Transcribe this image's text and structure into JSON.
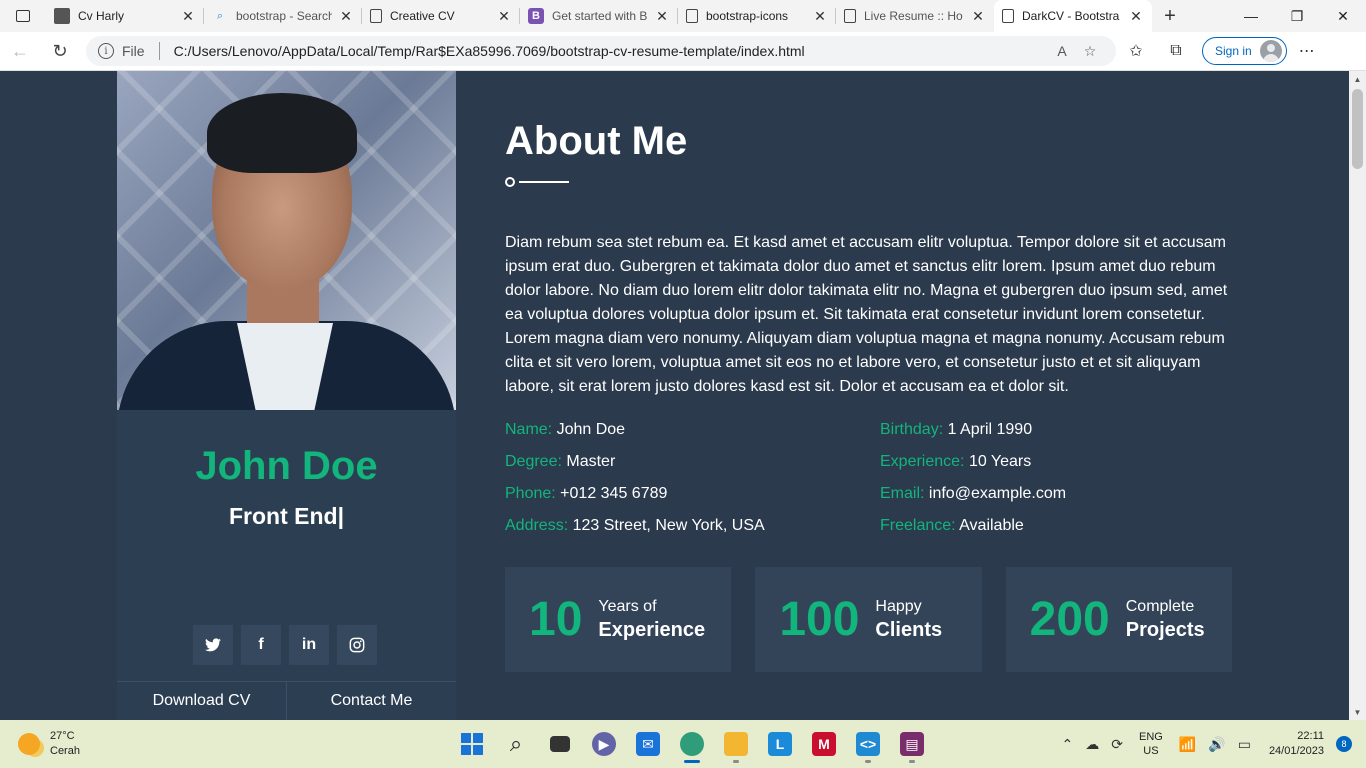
{
  "browser": {
    "tabs": [
      {
        "title": "Cv Harly",
        "icon": "user-photo-icon"
      },
      {
        "title": "bootstrap - Search",
        "icon": "search-icon"
      },
      {
        "title": "Creative CV",
        "icon": "page-icon"
      },
      {
        "title": "Get started with B",
        "icon": "bootstrap-icon"
      },
      {
        "title": "bootstrap-icons",
        "icon": "page-icon"
      },
      {
        "title": "Live Resume :: Ho",
        "icon": "page-icon"
      },
      {
        "title": "DarkCV - Bootstra",
        "icon": "page-icon",
        "active": true
      }
    ],
    "address": {
      "file_label": "File",
      "url": "C:/Users/Lenovo/AppData/Local/Temp/Rar$EXa85996.7069/bootstrap-cv-resume-template/index.html"
    },
    "sign_in_label": "Sign in"
  },
  "sidebar": {
    "name": "John Doe",
    "role": "Front End|",
    "socials": [
      {
        "name": "twitter-icon",
        "glyph": "🐦"
      },
      {
        "name": "facebook-icon",
        "glyph": "f"
      },
      {
        "name": "linkedin-icon",
        "glyph": "in"
      },
      {
        "name": "instagram-icon",
        "glyph": "◎"
      }
    ],
    "buttons": {
      "download": "Download CV",
      "contact": "Contact Me"
    }
  },
  "about": {
    "title": "About Me",
    "text": "Diam rebum sea stet rebum ea. Et kasd amet et accusam elitr voluptua. Tempor dolore sit et accusam ipsum erat duo. Gubergren et takimata dolor duo amet et sanctus elitr lorem. Ipsum amet duo rebum dolor labore. No diam duo lorem elitr dolor takimata elitr no. Magna et gubergren duo ipsum sed, amet ea voluptua dolores voluptua dolor ipsum et. Sit takimata erat consetetur invidunt lorem consetetur. Lorem magna diam vero nonumy. Aliquyam diam voluptua magna et magna nonumy. Accusam rebum clita et sit vero lorem, voluptua amet sit eos no et labore vero, et consetetur justo et et sit aliquyam labore, sit erat lorem justo dolores kasd est sit. Dolor et accusam ea et dolor sit.",
    "info": [
      {
        "key": "Name:",
        "value": "John Doe"
      },
      {
        "key": "Birthday:",
        "value": "1 April 1990"
      },
      {
        "key": "Degree:",
        "value": "Master"
      },
      {
        "key": "Experience:",
        "value": "10 Years"
      },
      {
        "key": "Phone:",
        "value": "+012 345 6789"
      },
      {
        "key": "Email:",
        "value": "info@example.com"
      },
      {
        "key": "Address:",
        "value": "123 Street, New York, USA"
      },
      {
        "key": "Freelance:",
        "value": "Available"
      }
    ],
    "stats": [
      {
        "number": "10",
        "line1": "Years of",
        "line2": "Experience"
      },
      {
        "number": "100",
        "line1": "Happy",
        "line2": "Clients"
      },
      {
        "number": "200",
        "line1": "Complete",
        "line2": "Projects"
      }
    ]
  },
  "taskbar": {
    "weather_temp": "27°C",
    "weather_desc": "Cerah",
    "lang": "ENG",
    "region": "US",
    "time": "22:11",
    "date": "24/01/2023",
    "notifications": "8"
  },
  "colors": {
    "page_bg": "#2b3a4d",
    "accent": "#12b57c",
    "card": "#334459"
  }
}
